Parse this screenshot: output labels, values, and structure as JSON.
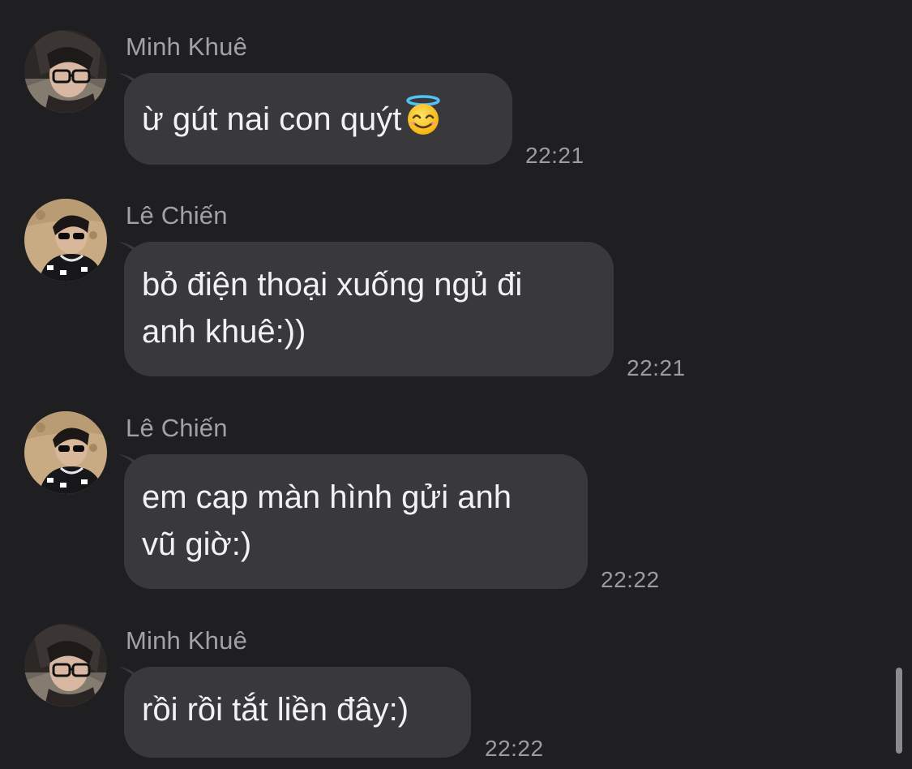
{
  "messages": [
    {
      "sender": "Minh Khuê",
      "text": "ừ gút nai con quýt",
      "emoji": "smiling-face-with-halo",
      "time": "22:21",
      "avatar": "avatar-minh-khue"
    },
    {
      "sender": "Lê Chiến",
      "text_line1": "bỏ điện thoại xuống ngủ đi",
      "text_line2": "anh khuê:))",
      "time": "22:21",
      "avatar": "avatar-le-chien"
    },
    {
      "sender": "Lê Chiến",
      "text_line1": "em cap màn hình gửi anh",
      "text_line2": "vũ giờ:)",
      "time": "22:22",
      "avatar": "avatar-le-chien"
    },
    {
      "sender": "Minh Khuê",
      "text": "rồi rồi tắt liền đây:)",
      "time": "22:22",
      "avatar": "avatar-minh-khue"
    }
  ],
  "colors": {
    "background": "#1f1f21",
    "bubble": "#39393c",
    "text": "#f2f2f4",
    "meta": "#a2a2a6"
  }
}
